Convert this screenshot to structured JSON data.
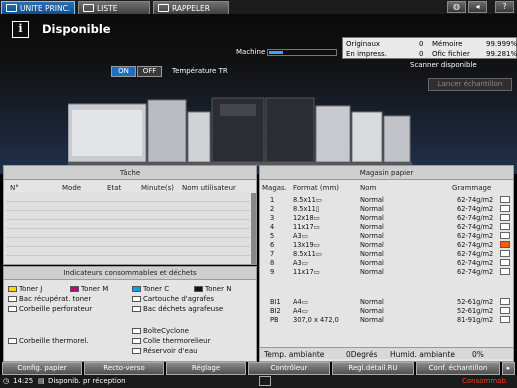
{
  "tabs": [
    {
      "label": "UNITE PRINC."
    },
    {
      "label": "LISTE TÂCHES"
    },
    {
      "label": "RAPPELER"
    }
  ],
  "top_icons": {
    "help_label": "?"
  },
  "status_title": "Disponible",
  "info_icon_label": "i",
  "machine_label": "Machine",
  "counters": {
    "originaux_label": "Originaux",
    "originaux_value": "0",
    "memoire_label": "Mémoire",
    "memoire_value": "99.999%",
    "en_impress_label": "En impress.",
    "en_impress_value": "0",
    "ofichier_label": "Ofic fichier",
    "ofichier_value": "99.281%"
  },
  "temperature": {
    "on_label": "ON",
    "off_label": "OFF",
    "label": "Température TR"
  },
  "scanner_status": "Scanner disponible",
  "lancer_button": "Lancer échantillon",
  "tache": {
    "title": "Tâche",
    "columns": [
      "N°",
      "Mode",
      "Etat",
      "Minute(s)",
      "Nom utilisateur"
    ]
  },
  "magasin": {
    "title": "Magasin papier",
    "columns": [
      "Magas.",
      "Format (mm)",
      "Nom",
      "Grammage"
    ],
    "rows": [
      {
        "num": "1",
        "format": "8.5x11▭",
        "nom": "Normal",
        "grammage": "62-74g/m2"
      },
      {
        "num": "2",
        "format": "8.5x11▯",
        "nom": "Normal",
        "grammage": "62-74g/m2"
      },
      {
        "num": "3",
        "format": "12x18▭",
        "nom": "Normal",
        "grammage": "62-74g/m2"
      },
      {
        "num": "4",
        "format": "11x17▭",
        "nom": "Normal",
        "grammage": "62-74g/m2"
      },
      {
        "num": "5",
        "format": "A3▭",
        "nom": "Normal",
        "grammage": "62-74g/m2"
      },
      {
        "num": "6",
        "format": "13x19▭",
        "nom": "Normal",
        "grammage": "62-74g/m2"
      },
      {
        "num": "7",
        "format": "8.5x11▭",
        "nom": "Normal",
        "grammage": "62-74g/m2"
      },
      {
        "num": "8",
        "format": "A3▭",
        "nom": "Normal",
        "grammage": "62-74g/m2"
      },
      {
        "num": "9",
        "format": "11x17▭",
        "nom": "Normal",
        "grammage": "62-74g/m2"
      }
    ],
    "extra_rows": [
      {
        "num": "BI1",
        "format": "A4▭",
        "nom": "Normal",
        "grammage": "52-61g/m2"
      },
      {
        "num": "BI2",
        "format": "A4▭",
        "nom": "Normal",
        "grammage": "52-61g/m2"
      },
      {
        "num": "PB",
        "format": "307,0 x 472,0",
        "nom": "Normal",
        "grammage": "81-91g/m2"
      }
    ],
    "temp_ambiante_label": "Temp. ambiante",
    "temp_ambiante_value": "0Degrés",
    "humid_label": "Humid. ambiante",
    "humid_value": "0%"
  },
  "consommables": {
    "title": "Indicateurs consommables et déchets",
    "toner_j": "Toner J",
    "toner_m": "Toner M",
    "toner_c": "Toner C",
    "toner_n": "Toner N",
    "bac_recup": "Bac récupérat. toner",
    "cartouche": "Cartouche d'agrafes",
    "corbeille_perf": "Corbeille perforateur",
    "bac_dechets": "Bac déchets agrafeuse",
    "boite": "BoîteCyclone",
    "corbeille_therm": "Corbeille thermorel.",
    "colle": "Colle thermorelieur",
    "reservoir": "Réservoir d'eau"
  },
  "bottom_buttons": [
    "Config. papier",
    "Recto-verso",
    "Réglage",
    "Contrôleur",
    "Regl.détail.RU",
    "Conf. échantillon"
  ],
  "footer": {
    "time": "14:25",
    "status": "Disponib. pr réception",
    "consommab": "Consommab."
  },
  "colors": {
    "accent_blue": "#0e4f8e",
    "warn_orange": "#f06000"
  }
}
